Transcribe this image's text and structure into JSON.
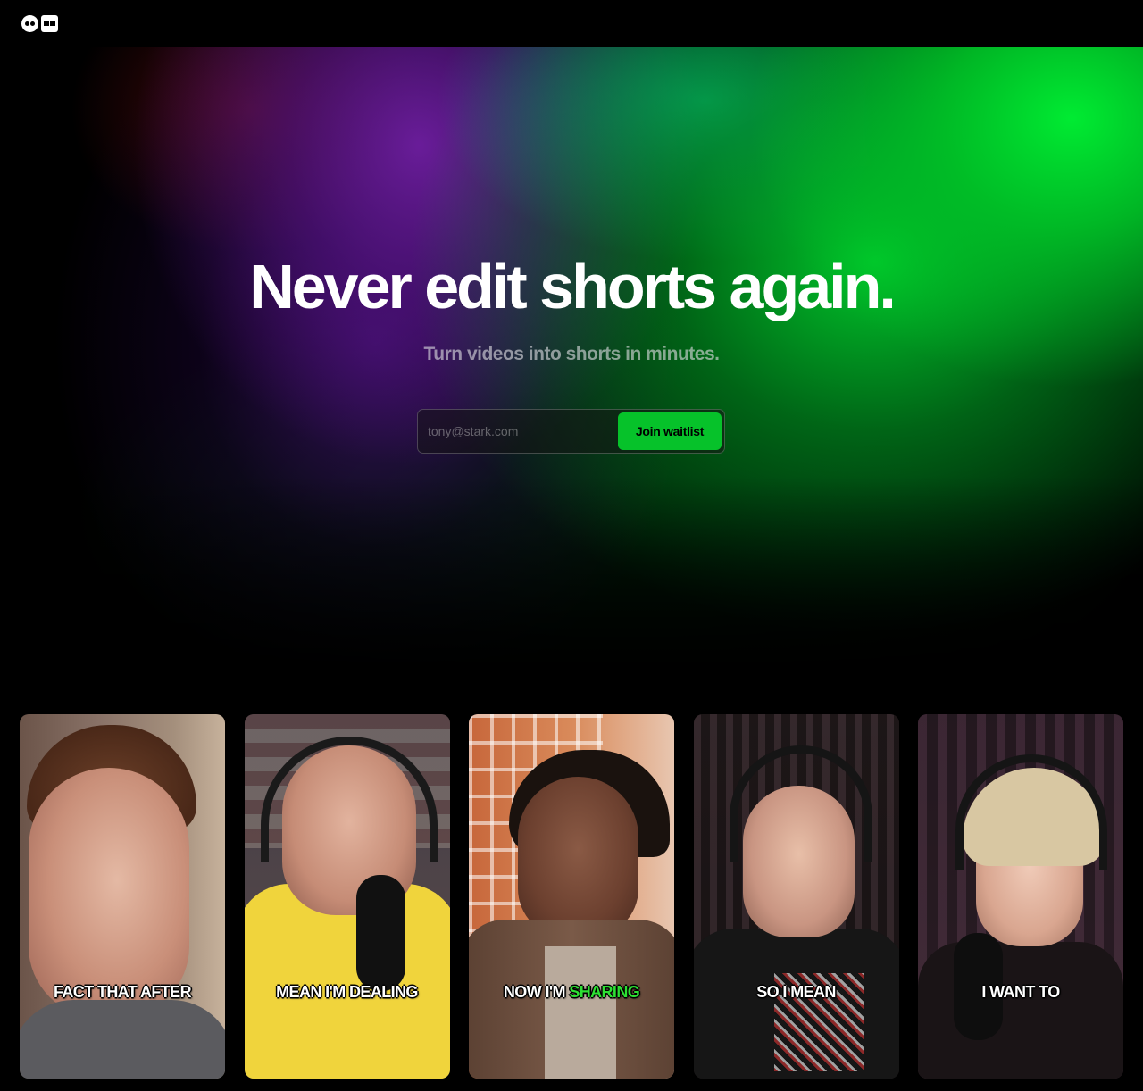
{
  "hero": {
    "headline": "Never edit shorts again.",
    "subheadline": "Turn videos into shorts in minutes."
  },
  "signup": {
    "email_placeholder": "tony@stark.com",
    "button_label": "Join waitlist",
    "accent_color": "#06c22a"
  },
  "cards": [
    {
      "caption": "FACT THAT AFTER"
    },
    {
      "caption": "MEAN I'M DEALING"
    },
    {
      "caption_pre": "NOW I'M ",
      "caption_highlight": "SHARING"
    },
    {
      "caption": "SO I MEAN"
    },
    {
      "caption": "I WANT TO"
    }
  ],
  "icons": {
    "logo": "brand-logo-icon"
  }
}
